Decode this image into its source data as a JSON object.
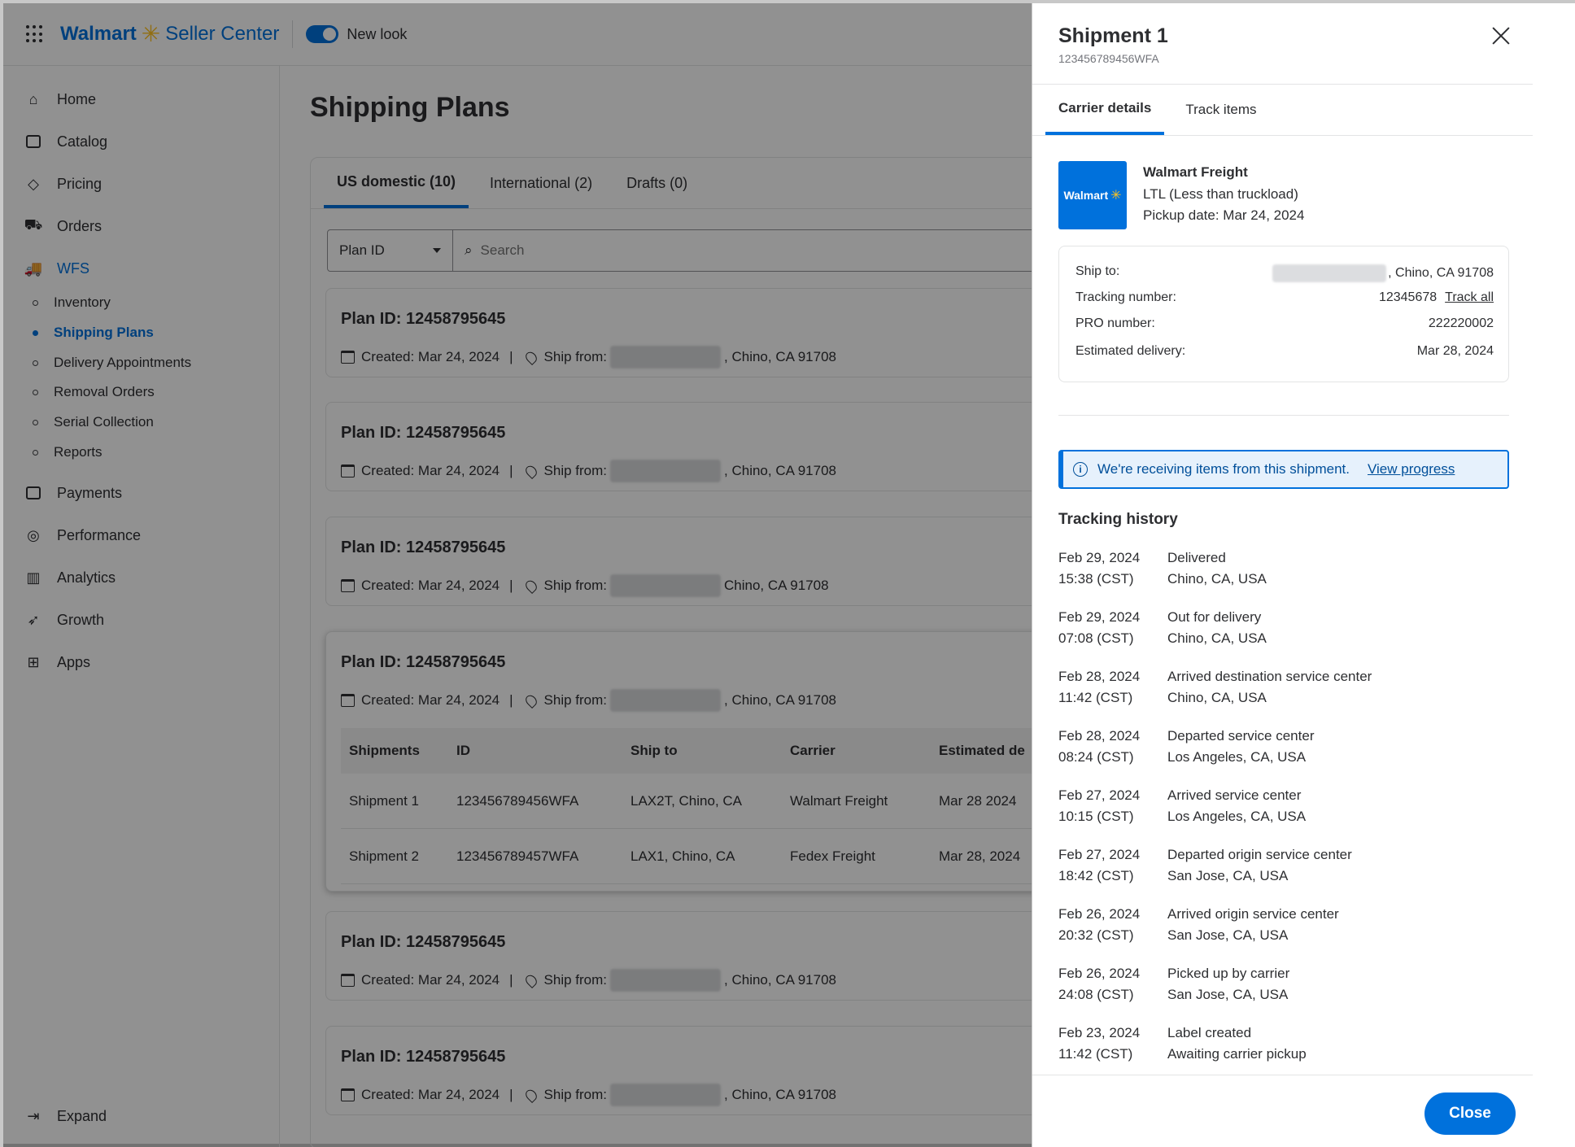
{
  "app": {
    "brand": "Walmart",
    "product": "Seller Center",
    "new_look_label": "New look",
    "new_look_on": true
  },
  "sidebar": {
    "items": [
      {
        "label": "Home",
        "icon": "home-icon"
      },
      {
        "label": "Catalog",
        "icon": "catalog-icon"
      },
      {
        "label": "Pricing",
        "icon": "tag-icon"
      },
      {
        "label": "Orders",
        "icon": "cart-icon"
      },
      {
        "label": "WFS",
        "icon": "truck-icon",
        "active": true
      }
    ],
    "wfs_sub": [
      {
        "label": "Inventory"
      },
      {
        "label": "Shipping Plans",
        "active": true
      },
      {
        "label": "Delivery Appointments"
      },
      {
        "label": "Removal Orders"
      },
      {
        "label": "Serial Collection"
      },
      {
        "label": "Reports"
      }
    ],
    "more_items": [
      {
        "label": "Payments",
        "icon": "payments-icon"
      },
      {
        "label": "Performance",
        "icon": "performance-icon"
      },
      {
        "label": "Analytics",
        "icon": "analytics-icon"
      },
      {
        "label": "Growth",
        "icon": "rocket-icon"
      },
      {
        "label": "Apps",
        "icon": "apps-icon"
      }
    ],
    "expand_label": "Expand"
  },
  "main": {
    "title": "Shipping Plans",
    "tabs": [
      {
        "label": "US domestic (10)",
        "active": true
      },
      {
        "label": "International (2)"
      },
      {
        "label": "Drafts (0)"
      }
    ],
    "filter_select": "Plan ID",
    "search_placeholder": "Search",
    "plans": [
      {
        "title": "Plan ID: 12458795645",
        "created": "Created: Mar 24, 2024",
        "ship_from_label": "Ship from:",
        "location": ", Chino, CA 91708"
      },
      {
        "title": "Plan ID: 12458795645",
        "created": "Created: Mar 24, 2024",
        "ship_from_label": "Ship from:",
        "location": ", Chino, CA 91708"
      },
      {
        "title": "Plan ID: 12458795645",
        "created": "Created: Mar 24, 2024",
        "ship_from_label": "Ship from:",
        "location": "Chino, CA 91708"
      },
      {
        "title": "Plan ID: 12458795645",
        "created": "Created: Mar 24, 2024",
        "ship_from_label": "Ship from:",
        "location": ", Chino, CA 91708"
      },
      {
        "title": "Plan ID: 12458795645",
        "created": "Created: Mar 24, 2024",
        "ship_from_label": "Ship from:",
        "location": ", Chino, CA 91708"
      },
      {
        "title": "Plan ID: 12458795645",
        "created": "Created: Mar 24, 2024",
        "ship_from_label": "Ship from:",
        "location": ", Chino, CA 91708"
      }
    ],
    "shipments_table": {
      "headers": [
        "Shipments",
        "ID",
        "Ship to",
        "Carrier",
        "Estimated de"
      ],
      "rows": [
        [
          "Shipment 1",
          "123456789456WFA",
          "LAX2T, Chino, CA",
          "Walmart Freight",
          "Mar 28 2024"
        ],
        [
          "Shipment 2",
          "123456789457WFA",
          "LAX1, Chino, CA",
          "Fedex Freight",
          "Mar 28, 2024"
        ]
      ]
    }
  },
  "panel": {
    "title": "Shipment 1",
    "subtitle": "123456789456WFA",
    "tabs": [
      {
        "label": "Carrier details",
        "active": true
      },
      {
        "label": "Track items"
      }
    ],
    "carrier": {
      "logo_text": "Walmart",
      "name": "Walmart Freight",
      "type": "LTL (Less than truckload)",
      "pickup": "Pickup date: Mar 24, 2024"
    },
    "details": [
      {
        "label": "Ship to:",
        "value": ", Chino, CA 91708"
      },
      {
        "label": "Tracking number:",
        "value": "12345678",
        "link": "Track all"
      },
      {
        "label": "PRO number:",
        "value": "222220002"
      },
      {
        "label": "Estimated delivery:",
        "value": "Mar 28, 2024"
      }
    ],
    "alert": {
      "text": "We're receiving items from this shipment.",
      "link": "View progress"
    },
    "history_title": "Tracking history",
    "history": [
      {
        "date": "Feb 29, 2024",
        "time": "15:38 (CST)",
        "event": "Delivered",
        "place": "Chino, CA, USA"
      },
      {
        "date": "Feb 29, 2024",
        "time": "07:08 (CST)",
        "event": "Out for delivery",
        "place": "Chino, CA, USA"
      },
      {
        "date": "Feb 28, 2024",
        "time": "11:42 (CST)",
        "event": "Arrived destination service center",
        "place": "Chino, CA, USA"
      },
      {
        "date": "Feb 28, 2024",
        "time": "08:24 (CST)",
        "event": "Departed service center",
        "place": "Los Angeles, CA, USA"
      },
      {
        "date": "Feb 27, 2024",
        "time": "10:15 (CST)",
        "event": "Arrived service center",
        "place": "Los Angeles, CA, USA"
      },
      {
        "date": "Feb 27, 2024",
        "time": "18:42 (CST)",
        "event": "Departed origin service center",
        "place": "San Jose, CA, USA"
      },
      {
        "date": "Feb 26, 2024",
        "time": "20:32 (CST)",
        "event": "Arrived origin service center",
        "place": "San Jose, CA, USA"
      },
      {
        "date": "Feb 26, 2024",
        "time": "24:08 (CST)",
        "event": "Picked up by carrier",
        "place": "San Jose, CA, USA"
      },
      {
        "date": "Feb 23, 2024",
        "time": "11:42 (CST)",
        "event": "Label created",
        "place": "Awaiting carrier pickup"
      }
    ],
    "close_label": "Close"
  },
  "colors": {
    "accent": "#0071dc",
    "spark": "#ffc220",
    "alert_bg": "#e6f1fc"
  }
}
